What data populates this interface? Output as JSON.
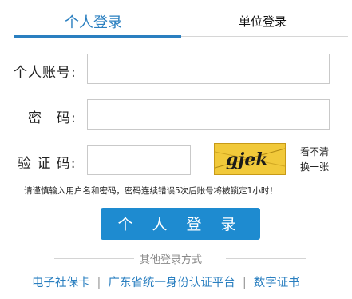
{
  "tabs": {
    "personal": "个人登录",
    "organization": "单位登录"
  },
  "form": {
    "account_label": "个人账号:",
    "password_label": "密　码:",
    "captcha_label": "验 证 码:",
    "account_value": "",
    "password_value": "",
    "captcha_value": "",
    "captcha_text": "gjek",
    "refresh_line1": "看不清",
    "refresh_line2": "换一张"
  },
  "notice": "请谨慎输入用户名和密码，密码连续错误5次后账号将被锁定1小时！",
  "login_button": "个 人 登 录",
  "other": {
    "title": "其他登录方式",
    "links": [
      "电子社保卡",
      "广东省统一身份认证平台",
      "数字证书"
    ],
    "separator": "|"
  },
  "colors": {
    "accent": "#2a7fc0",
    "button": "#1e8bd0",
    "captcha_bg": "#f1c93a"
  }
}
